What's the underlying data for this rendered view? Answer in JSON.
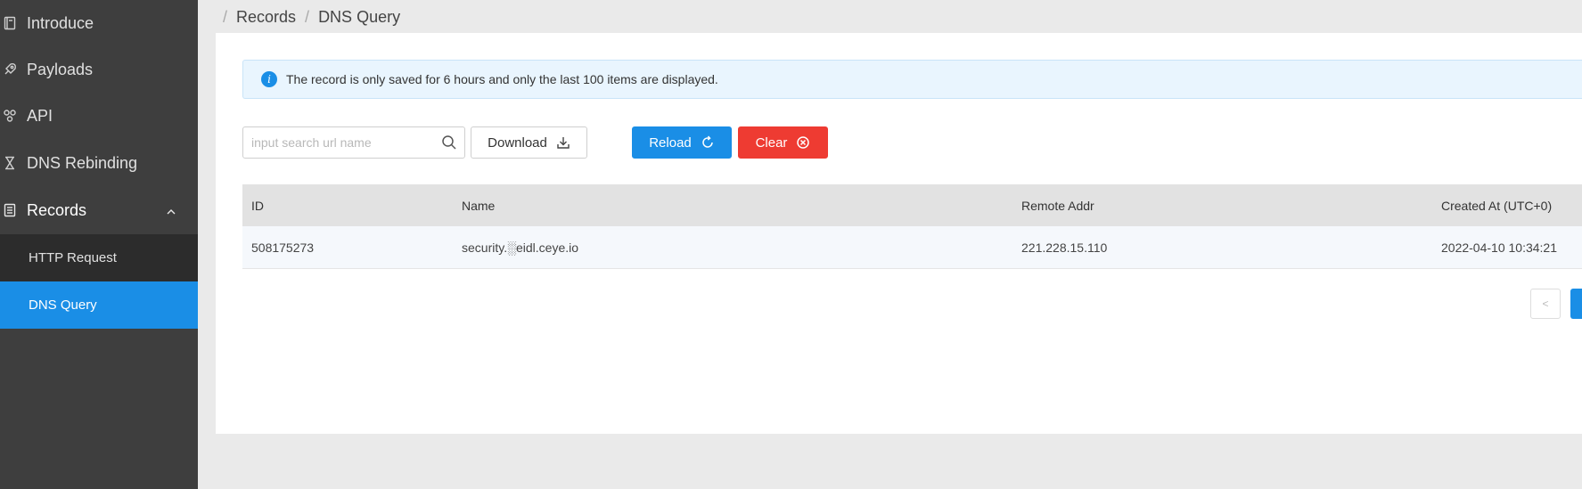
{
  "sidebar": {
    "items": [
      {
        "label": "Introduce",
        "icon": "book-icon"
      },
      {
        "label": "Payloads",
        "icon": "rocket-icon"
      },
      {
        "label": "API",
        "icon": "api-icon"
      },
      {
        "label": "DNS Rebinding",
        "icon": "hourglass-icon"
      },
      {
        "label": "Records",
        "icon": "list-icon",
        "expanded": true
      }
    ],
    "sub_items": [
      {
        "label": "HTTP Request"
      },
      {
        "label": "DNS Query",
        "selected": true
      }
    ]
  },
  "breadcrumb": {
    "items": [
      "Records",
      "DNS Query"
    ],
    "separator": "/"
  },
  "alert": {
    "text": "The record is only saved for 6 hours and only the last 100 items are displayed."
  },
  "toolbar": {
    "search_placeholder": "input search url name",
    "download_label": "Download",
    "reload_label": "Reload",
    "clear_label": "Clear"
  },
  "table": {
    "columns": [
      "ID",
      "Name",
      "Remote Addr",
      "Created At (UTC+0)"
    ],
    "rows": [
      {
        "id": "508175273",
        "name": "security.░eidl.ceye.io",
        "remote_addr": "221.228.15.110",
        "created_at": "2022-04-10 10:34:21"
      }
    ]
  },
  "colors": {
    "sidebar_bg": "#3e3e3e",
    "submenu_bg": "#2c2c2c",
    "accent_blue": "#1a8ee6",
    "danger_red": "#ee3b32",
    "alert_bg": "#e9f5fe"
  },
  "pagination": {
    "prev_symbol": "<"
  }
}
